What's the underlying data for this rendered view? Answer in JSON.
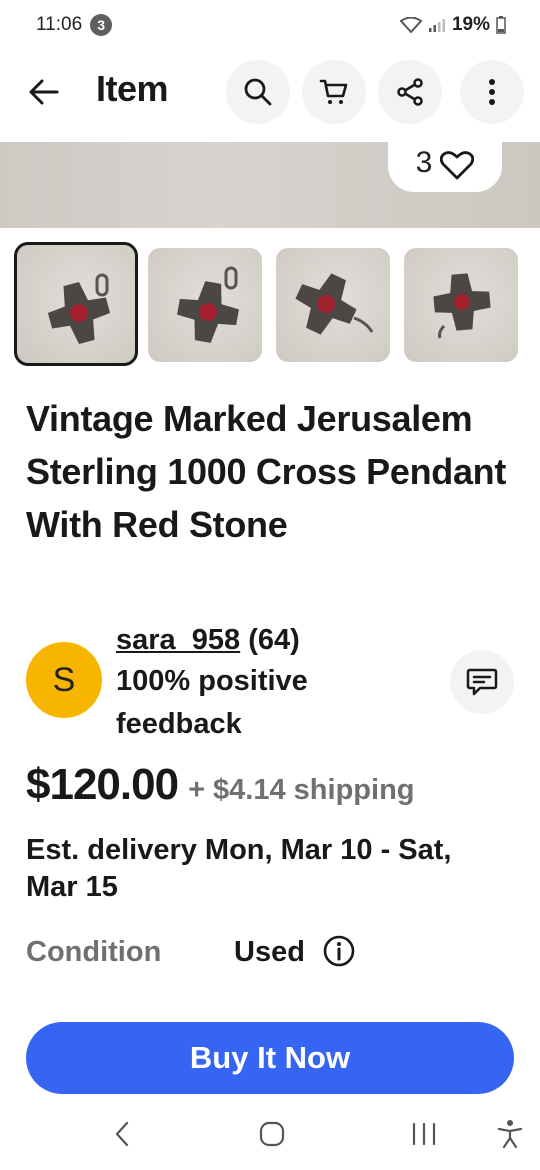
{
  "status_bar": {
    "time": "11:06",
    "notification_count": "3",
    "battery": "19%"
  },
  "app_bar": {
    "title": "Item",
    "icons": [
      "back-arrow-icon",
      "search-icon",
      "cart-icon",
      "share-icon",
      "more-vert-icon"
    ]
  },
  "gallery": {
    "watch_count": "3",
    "thumbnail_count": 4,
    "selected_index": 0
  },
  "listing": {
    "title": "Vintage Marked Jerusalem Sterling 1000 Cross Pendant With Red Stone"
  },
  "seller": {
    "avatar_initial": "S",
    "username": "sara_958",
    "feedback_count": "(64)",
    "feedback_text": "100% positive feedback"
  },
  "pricing": {
    "price": "$120.00",
    "shipping": "+ $4.14 shipping",
    "delivery": "Est. delivery Mon, Mar 10 - Sat, Mar 15"
  },
  "condition": {
    "label": "Condition",
    "value": "Used"
  },
  "buy_button": {
    "label": "Buy It Now"
  },
  "colors": {
    "accent": "#3665f3",
    "avatar": "#f7b500",
    "muted_text": "#707070"
  }
}
